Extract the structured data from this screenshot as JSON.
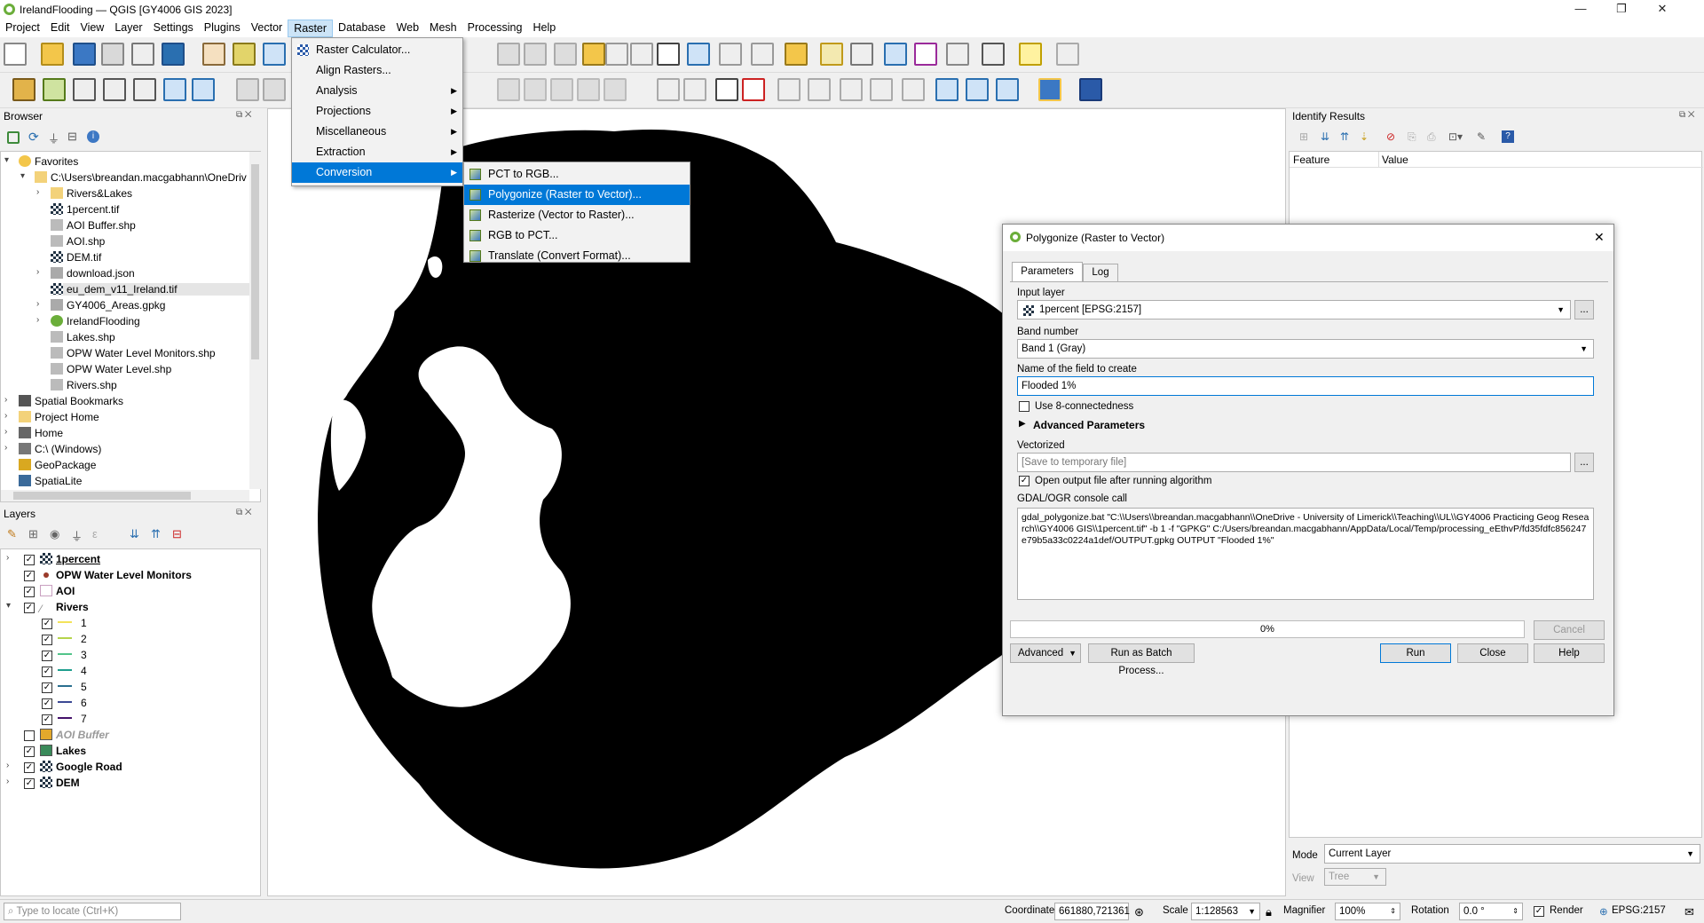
{
  "window": {
    "title": "IrelandFlooding — QGIS [GY4006 GIS 2023]",
    "minimize": "—",
    "maximize": "❐",
    "close": "✕"
  },
  "menubar": [
    "Project",
    "Edit",
    "View",
    "Layer",
    "Settings",
    "Plugins",
    "Vector",
    "Raster",
    "Database",
    "Web",
    "Mesh",
    "Processing",
    "Help"
  ],
  "raster_menu": {
    "items": [
      "Raster Calculator...",
      "Align Rasters...",
      "Analysis",
      "Projections",
      "Miscellaneous",
      "Extraction",
      "Conversion"
    ],
    "conversion_items": [
      "PCT to RGB...",
      "Polygonize (Raster to Vector)...",
      "Rasterize (Vector to Raster)...",
      "RGB to PCT...",
      "Translate (Convert Format)..."
    ]
  },
  "browser": {
    "title": "Browser",
    "items": [
      {
        "label": "Favorites",
        "icon": "star-icon",
        "level": 0,
        "expander": "▾"
      },
      {
        "label": "C:\\Users\\breandan.macgabhann\\OneDriv",
        "icon": "folder-icon",
        "level": 1,
        "expander": "▾"
      },
      {
        "label": "Rivers&Lakes",
        "icon": "folder-icon",
        "level": 2,
        "expander": "›"
      },
      {
        "label": "1percent.tif",
        "icon": "raster-icon",
        "level": 2,
        "expander": ""
      },
      {
        "label": "AOI Buffer.shp",
        "icon": "vector-icon",
        "level": 2,
        "expander": ""
      },
      {
        "label": "AOI.shp",
        "icon": "vector-icon",
        "level": 2,
        "expander": ""
      },
      {
        "label": "DEM.tif",
        "icon": "raster-icon",
        "level": 2,
        "expander": ""
      },
      {
        "label": "download.json",
        "icon": "db-icon",
        "level": 2,
        "expander": "›"
      },
      {
        "label": "eu_dem_v11_Ireland.tif",
        "icon": "raster-icon",
        "level": 2,
        "expander": ""
      },
      {
        "label": "GY4006_Areas.gpkg",
        "icon": "db-icon",
        "level": 2,
        "expander": "›"
      },
      {
        "label": "IrelandFlooding",
        "icon": "qgis-icon",
        "level": 2,
        "expander": "›"
      },
      {
        "label": "Lakes.shp",
        "icon": "vector-icon",
        "level": 2,
        "expander": ""
      },
      {
        "label": "OPW Water Level Monitors.shp",
        "icon": "vector-icon",
        "level": 2,
        "expander": ""
      },
      {
        "label": "OPW Water Level.shp",
        "icon": "vector-icon",
        "level": 2,
        "expander": ""
      },
      {
        "label": "Rivers.shp",
        "icon": "vector-icon",
        "level": 2,
        "expander": ""
      },
      {
        "label": "Spatial Bookmarks",
        "icon": "bookmark-icon",
        "level": 0,
        "expander": "›"
      },
      {
        "label": "Project Home",
        "icon": "folder-icon",
        "level": 0,
        "expander": "›"
      },
      {
        "label": "Home",
        "icon": "home-icon",
        "level": 0,
        "expander": "›"
      },
      {
        "label": "C:\\ (Windows)",
        "icon": "drive-icon",
        "level": 0,
        "expander": "›"
      },
      {
        "label": "GeoPackage",
        "icon": "geopackage-icon",
        "level": 0,
        "expander": ""
      },
      {
        "label": "SpatiaLite",
        "icon": "spatialite-icon",
        "level": 0,
        "expander": ""
      }
    ]
  },
  "layers": {
    "title": "Layers",
    "items": [
      {
        "label": "1percent",
        "checked": true,
        "bold": true,
        "underline": true,
        "icon": "raster-icon",
        "indent": 0,
        "expander": "›"
      },
      {
        "label": "OPW Water Level Monitors",
        "checked": true,
        "bold": true,
        "icon": "point-icon",
        "indent": 0,
        "expander": ""
      },
      {
        "label": "AOI",
        "checked": true,
        "bold": true,
        "icon": "polygon-icon",
        "indent": 0,
        "expander": ""
      },
      {
        "label": "Rivers",
        "checked": true,
        "bold": true,
        "icon": "line-icon",
        "indent": 0,
        "expander": "▾"
      },
      {
        "label": "1",
        "checked": true,
        "bold": false,
        "color": "#f3e35a",
        "indent": 1,
        "expander": ""
      },
      {
        "label": "2",
        "checked": true,
        "bold": false,
        "color": "#b5d44b",
        "indent": 1,
        "expander": ""
      },
      {
        "label": "3",
        "checked": true,
        "bold": false,
        "color": "#52c48a",
        "indent": 1,
        "expander": ""
      },
      {
        "label": "4",
        "checked": true,
        "bold": false,
        "color": "#1e9e8e",
        "indent": 1,
        "expander": ""
      },
      {
        "label": "5",
        "checked": true,
        "bold": false,
        "color": "#2a6f8f",
        "indent": 1,
        "expander": ""
      },
      {
        "label": "6",
        "checked": true,
        "bold": false,
        "color": "#3b4994",
        "indent": 1,
        "expander": ""
      },
      {
        "label": "7",
        "checked": true,
        "bold": false,
        "color": "#44116a",
        "indent": 1,
        "expander": ""
      },
      {
        "label": "AOI Buffer",
        "checked": false,
        "bold": true,
        "italic": true,
        "icon": "fill-icon",
        "color": "#e3a92c",
        "indent": 0,
        "expander": ""
      },
      {
        "label": "Lakes",
        "checked": true,
        "bold": true,
        "icon": "fill-icon",
        "color": "#3a8a5a",
        "indent": 0,
        "expander": ""
      },
      {
        "label": "Google Road",
        "checked": true,
        "bold": true,
        "icon": "raster-icon",
        "indent": 0,
        "expander": "›"
      },
      {
        "label": "DEM",
        "checked": true,
        "bold": true,
        "icon": "raster-icon",
        "indent": 0,
        "expander": "›"
      }
    ]
  },
  "identify": {
    "title": "Identify Results",
    "col_feature": "Feature",
    "col_value": "Value",
    "mode_label": "Mode",
    "mode_value": "Current Layer",
    "view_label": "View",
    "view_value": "Tree"
  },
  "dialog": {
    "title": "Polygonize (Raster to Vector)",
    "tabs": [
      "Parameters",
      "Log"
    ],
    "input_layer_label": "Input layer",
    "input_layer_value": "1percent [EPSG:2157]",
    "band_label": "Band number",
    "band_value": "Band 1 (Gray)",
    "field_label": "Name of the field to create",
    "field_value": "Flooded 1%",
    "connectedness_label": "Use 8-connectedness",
    "advanced_label": "Advanced Parameters",
    "vectorized_label": "Vectorized",
    "vectorized_placeholder": "[Save to temporary file]",
    "open_output_label": "Open output file after running algorithm",
    "console_label": "GDAL/OGR console call",
    "console_text": "gdal_polygonize.bat \"C:\\\\Users\\\\breandan.macgabhann\\\\OneDrive - University of Limerick\\\\Teaching\\\\UL\\\\GY4006 Practicing Geog Research\\\\GY4006 GIS\\\\1percent.tif\" -b 1 -f \"GPKG\" C:/Users/breandan.macgabhann/AppData/Local/Temp/processing_eEthvP/fd35fdfc856247e79b5a33c0224a1def/OUTPUT.gpkg OUTPUT \"Flooded 1%\"",
    "progress_text": "0%",
    "progress": 0,
    "cancel": "Cancel",
    "advanced_btn": "Advanced",
    "batch_btn": "Run as Batch Process...",
    "run": "Run",
    "close": "Close",
    "help": "Help",
    "ellipsis": "..."
  },
  "statusbar": {
    "locate_placeholder": "Type to locate (Ctrl+K)",
    "coordinate_label": "Coordinate",
    "coordinate_value": "661880,721361",
    "scale_label": "Scale",
    "scale_value": "1:128563",
    "magnifier_label": "Magnifier",
    "magnifier_value": "100%",
    "rotation_label": "Rotation",
    "rotation_value": "0.0 °",
    "render_label": "Render",
    "crs_label": "EPSG:2157"
  }
}
